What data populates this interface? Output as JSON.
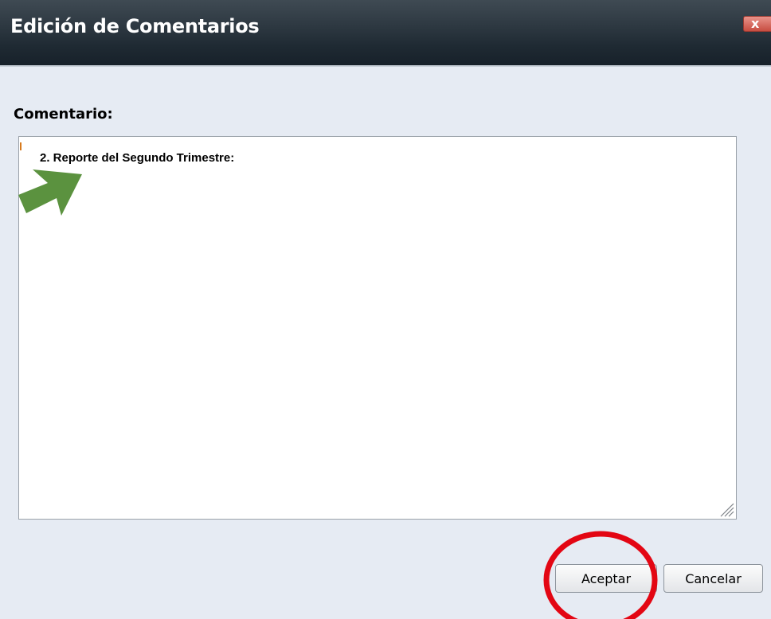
{
  "dialog": {
    "title": "Edición de Comentarios",
    "close_icon": "close-icon",
    "close_label": "x"
  },
  "form": {
    "comment_label": "Comentario:",
    "comment_text": "2. Reporte del Segundo Trimestre:"
  },
  "buttons": {
    "accept_label": "Aceptar",
    "cancel_label": "Cancelar"
  },
  "annotations": {
    "arrow_icon": "arrow-icon",
    "arrow_color": "#5b923f",
    "circle_icon": "circle-highlight-icon",
    "circle_color": "#e30613"
  },
  "colors": {
    "titlebar": "#1f2a33",
    "dialog_background": "#e6ebf3",
    "close_button": "#c74d41"
  }
}
